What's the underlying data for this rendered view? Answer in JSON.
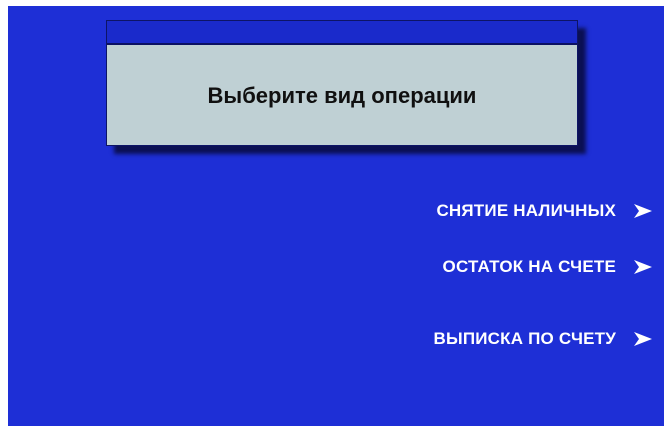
{
  "screen": {
    "background_color": "#1e2fd6",
    "prompt_box_color": "#bfd0d4"
  },
  "prompt": {
    "text": "Выберите вид операции"
  },
  "menu": {
    "items": [
      {
        "label": "СНЯТИЕ НАЛИЧНЫХ",
        "icon": "chevron-right-icon"
      },
      {
        "label": "ОСТАТОК НА СЧЕТЕ",
        "icon": "chevron-right-icon"
      },
      {
        "label": "ВЫПИСКА ПО СЧЕТУ",
        "icon": "chevron-right-icon"
      }
    ]
  }
}
